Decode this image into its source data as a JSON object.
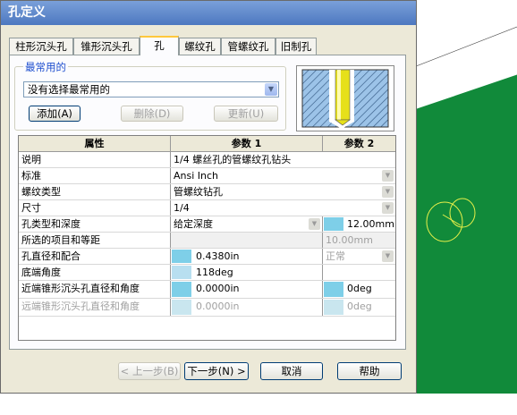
{
  "dialog": {
    "title": "孔定义",
    "tabs": [
      "柱形沉头孔",
      "锥形沉头孔",
      "孔",
      "螺纹孔",
      "管螺纹孔",
      "旧制孔"
    ],
    "active_tab": "孔",
    "favorites": {
      "group_label": "最常用的",
      "select_value": "没有选择最常用的",
      "add_label": "添加(A)",
      "delete_label": "删除(D)",
      "update_label": "更新(U)"
    },
    "grid": {
      "headers": [
        "属性",
        "参数 1",
        "参数 2"
      ],
      "rows": [
        {
          "prop": "说明",
          "p1": "1/4 螺丝孔的管螺纹孔钻头",
          "p2": ""
        },
        {
          "prop": "标准",
          "p1": "Ansi Inch",
          "p2": ""
        },
        {
          "prop": "螺纹类型",
          "p1": "管螺纹钻孔",
          "p2": ""
        },
        {
          "prop": "尺寸",
          "p1": "1/4",
          "p2": ""
        },
        {
          "prop": "孔类型和深度",
          "p1": "给定深度",
          "p2": "12.00mm"
        },
        {
          "prop": "所选的项目和等距",
          "p1": "",
          "p2": "10.00mm"
        },
        {
          "prop": "孔直径和配合",
          "p1": "0.4380in",
          "p2": "正常"
        },
        {
          "prop": "底端角度",
          "p1": "118deg",
          "p2": ""
        },
        {
          "prop": "近端锥形沉头孔直径和角度",
          "p1": "0.0000in",
          "p2": "0deg"
        },
        {
          "prop": "远端锥形沉头孔直径和角度",
          "p1": "0.0000in",
          "p2": "0deg"
        }
      ]
    },
    "buttons": {
      "back": "< 上一步(B)",
      "next": "下一步(N) >",
      "cancel": "取消",
      "help": "帮助"
    },
    "colors": {
      "accent": "#4d78c0",
      "tab_highlight": "#ffc83c",
      "background_3d": "#118a3a",
      "picture": "#7ecfe8"
    }
  }
}
